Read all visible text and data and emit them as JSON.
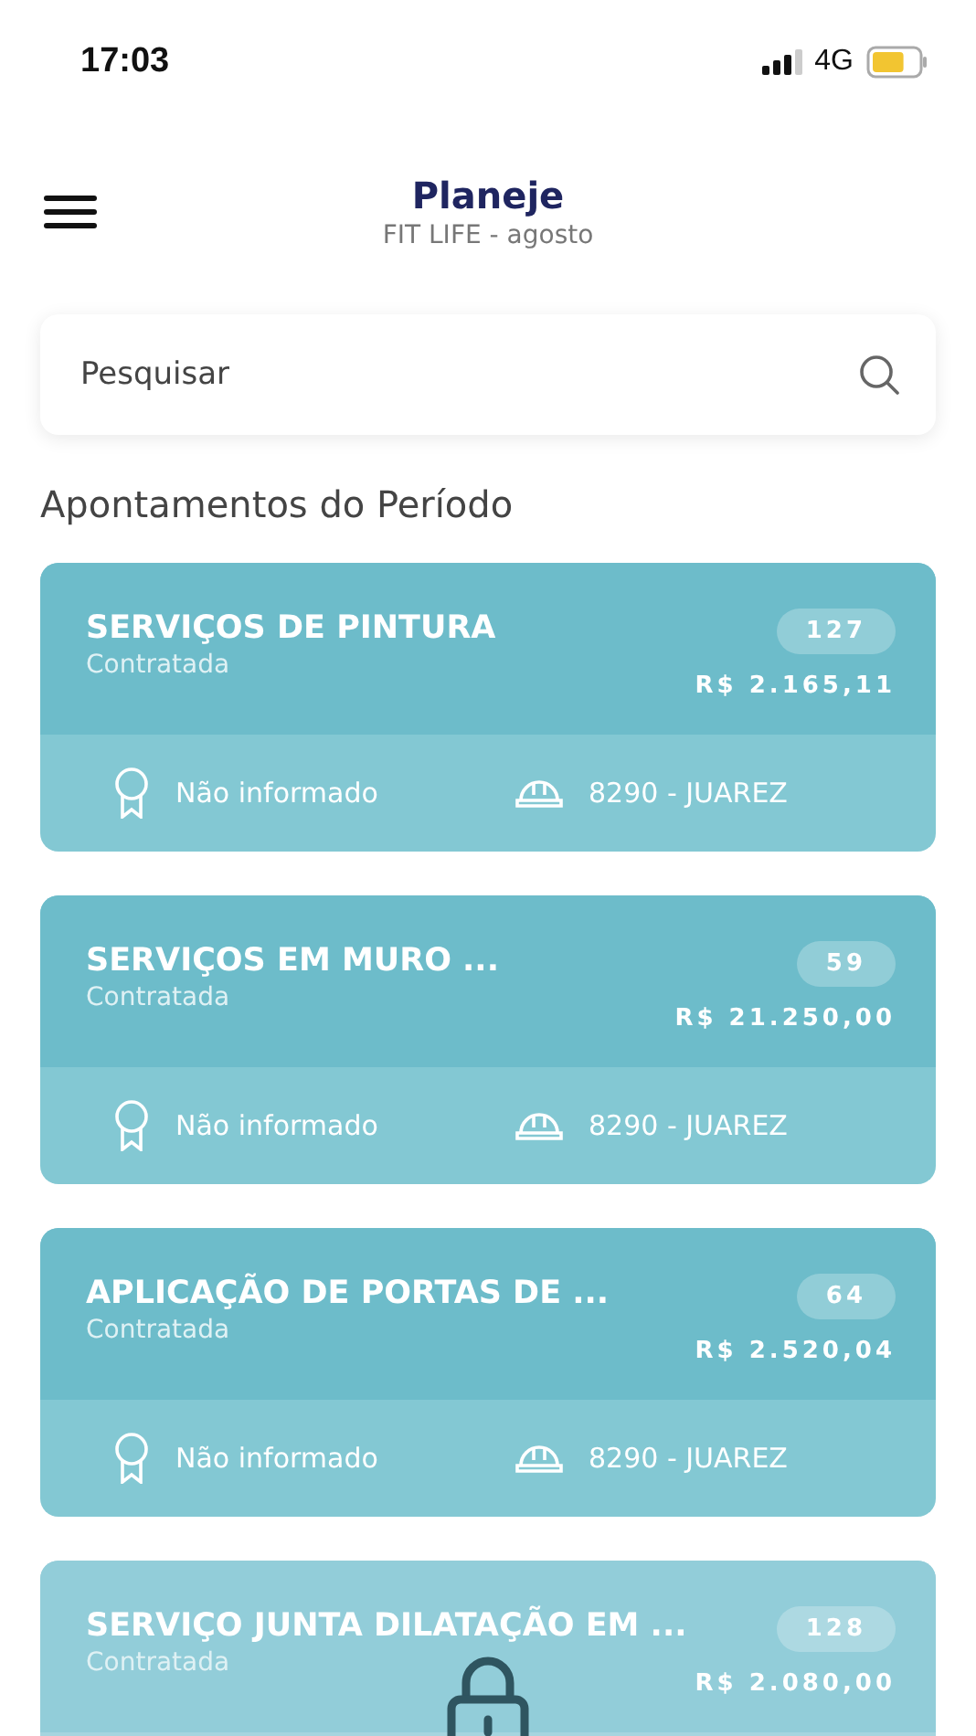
{
  "status_bar": {
    "time": "17:03",
    "network": "4G"
  },
  "header": {
    "title": "Planeje",
    "subtitle": "FIT LIFE - agosto"
  },
  "search": {
    "placeholder": "Pesquisar"
  },
  "section_title": "Apontamentos do Período",
  "cards": [
    {
      "title": "SERVIÇOS DE PINTURA",
      "status": "Contratada",
      "count": "127",
      "amount": "R$ 2.165,11",
      "certification": "Não informado",
      "worker": "8290 - JUAREZ",
      "locked": false
    },
    {
      "title": "SERVIÇOS EM MURO ...",
      "status": "Contratada",
      "count": "59",
      "amount": "R$ 21.250,00",
      "certification": "Não informado",
      "worker": "8290 - JUAREZ",
      "locked": false
    },
    {
      "title": "APLICAÇÃO DE PORTAS DE ...",
      "status": "Contratada",
      "count": "64",
      "amount": "R$ 2.520,04",
      "certification": "Não informado",
      "worker": "8290 - JUAREZ",
      "locked": false
    },
    {
      "title": "SERVIÇO JUNTA DILATAÇÃO EM ...",
      "status": "Contratada",
      "count": "128",
      "amount": "R$ 2.080,00",
      "locked": true
    }
  ]
}
